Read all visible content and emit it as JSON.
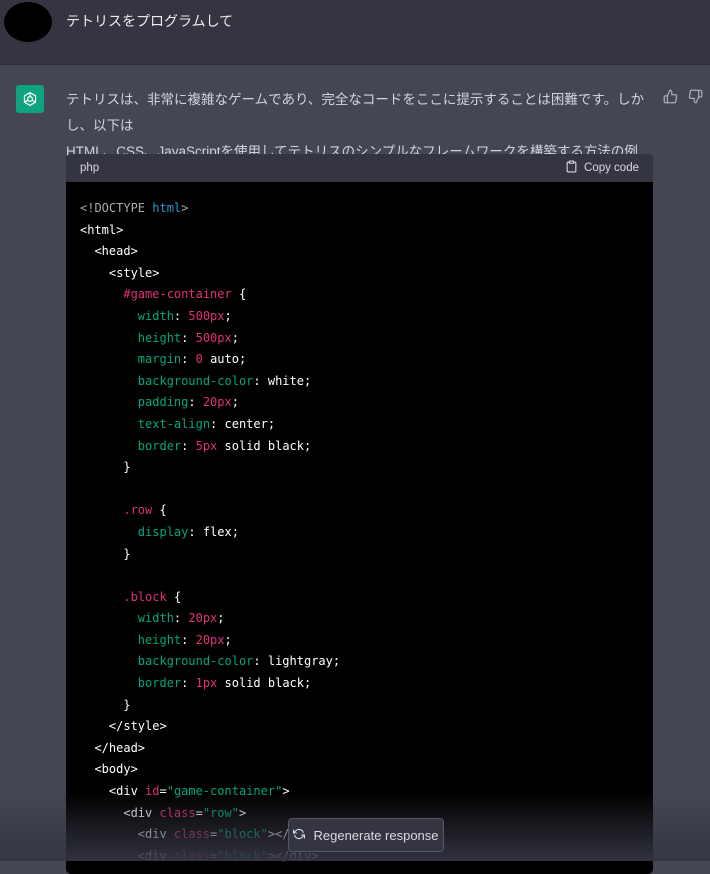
{
  "user_message": {
    "text": "テトリスをプログラムして"
  },
  "assistant": {
    "intro_line1": "テトリスは、非常に複雑なゲームであり、完全なコードをここに提示することは困難です。しかし、以下は",
    "intro_line2": "HTML、CSS、JavaScriptを使用してテトリスのシンプルなフレームワークを構築する方法の例です。",
    "code": {
      "language": "php",
      "copy_label": "Copy code",
      "lines": [
        [
          {
            "t": "<!DOCTYPE ",
            "c": "c"
          },
          {
            "t": "html",
            "c": "t"
          },
          {
            "t": ">",
            "c": "c"
          }
        ],
        [
          {
            "t": "<html>",
            "c": ""
          }
        ],
        [
          {
            "t": "  <head>",
            "c": ""
          }
        ],
        [
          {
            "t": "    <style>",
            "c": ""
          }
        ],
        [
          {
            "t": "      ",
            "c": ""
          },
          {
            "t": "#game-container",
            "c": "n"
          },
          {
            "t": " {",
            "c": ""
          }
        ],
        [
          {
            "t": "        ",
            "c": ""
          },
          {
            "t": "width",
            "c": "k"
          },
          {
            "t": ": ",
            "c": ""
          },
          {
            "t": "500px",
            "c": "n"
          },
          {
            "t": ";",
            "c": ""
          }
        ],
        [
          {
            "t": "        ",
            "c": ""
          },
          {
            "t": "height",
            "c": "k"
          },
          {
            "t": ": ",
            "c": ""
          },
          {
            "t": "500px",
            "c": "n"
          },
          {
            "t": ";",
            "c": ""
          }
        ],
        [
          {
            "t": "        ",
            "c": ""
          },
          {
            "t": "margin",
            "c": "k"
          },
          {
            "t": ": ",
            "c": ""
          },
          {
            "t": "0",
            "c": "n"
          },
          {
            "t": " auto;",
            "c": ""
          }
        ],
        [
          {
            "t": "        ",
            "c": ""
          },
          {
            "t": "background-color",
            "c": "k"
          },
          {
            "t": ": white;",
            "c": ""
          }
        ],
        [
          {
            "t": "        ",
            "c": ""
          },
          {
            "t": "padding",
            "c": "k"
          },
          {
            "t": ": ",
            "c": ""
          },
          {
            "t": "20px",
            "c": "n"
          },
          {
            "t": ";",
            "c": ""
          }
        ],
        [
          {
            "t": "        ",
            "c": ""
          },
          {
            "t": "text-align",
            "c": "k"
          },
          {
            "t": ": center;",
            "c": ""
          }
        ],
        [
          {
            "t": "        ",
            "c": ""
          },
          {
            "t": "border",
            "c": "k"
          },
          {
            "t": ": ",
            "c": ""
          },
          {
            "t": "5px",
            "c": "n"
          },
          {
            "t": " solid black;",
            "c": ""
          }
        ],
        [
          {
            "t": "      }",
            "c": ""
          }
        ],
        [
          {
            "t": "",
            "c": ""
          }
        ],
        [
          {
            "t": "      ",
            "c": ""
          },
          {
            "t": ".row",
            "c": "n"
          },
          {
            "t": " {",
            "c": ""
          }
        ],
        [
          {
            "t": "        ",
            "c": ""
          },
          {
            "t": "display",
            "c": "k"
          },
          {
            "t": ": flex;",
            "c": ""
          }
        ],
        [
          {
            "t": "      }",
            "c": ""
          }
        ],
        [
          {
            "t": "",
            "c": ""
          }
        ],
        [
          {
            "t": "      ",
            "c": ""
          },
          {
            "t": ".block",
            "c": "n"
          },
          {
            "t": " {",
            "c": ""
          }
        ],
        [
          {
            "t": "        ",
            "c": ""
          },
          {
            "t": "width",
            "c": "k"
          },
          {
            "t": ": ",
            "c": ""
          },
          {
            "t": "20px",
            "c": "n"
          },
          {
            "t": ";",
            "c": ""
          }
        ],
        [
          {
            "t": "        ",
            "c": ""
          },
          {
            "t": "height",
            "c": "k"
          },
          {
            "t": ": ",
            "c": ""
          },
          {
            "t": "20px",
            "c": "n"
          },
          {
            "t": ";",
            "c": ""
          }
        ],
        [
          {
            "t": "        ",
            "c": ""
          },
          {
            "t": "background-color",
            "c": "k"
          },
          {
            "t": ": lightgray;",
            "c": ""
          }
        ],
        [
          {
            "t": "        ",
            "c": ""
          },
          {
            "t": "border",
            "c": "k"
          },
          {
            "t": ": ",
            "c": ""
          },
          {
            "t": "1px",
            "c": "n"
          },
          {
            "t": " solid black;",
            "c": ""
          }
        ],
        [
          {
            "t": "      }",
            "c": ""
          }
        ],
        [
          {
            "t": "    </style>",
            "c": ""
          }
        ],
        [
          {
            "t": "  </head>",
            "c": ""
          }
        ],
        [
          {
            "t": "  <body>",
            "c": ""
          }
        ],
        [
          {
            "t": "    <div ",
            "c": ""
          },
          {
            "t": "id",
            "c": "n"
          },
          {
            "t": "=",
            "c": ""
          },
          {
            "t": "\"game-container\"",
            "c": "s"
          },
          {
            "t": ">",
            "c": ""
          }
        ],
        [
          {
            "t": "      <div ",
            "c": ""
          },
          {
            "t": "class",
            "c": "n"
          },
          {
            "t": "=",
            "c": ""
          },
          {
            "t": "\"row\"",
            "c": "s"
          },
          {
            "t": ">",
            "c": ""
          }
        ],
        [
          {
            "t": "        <div ",
            "c": ""
          },
          {
            "t": "class",
            "c": "n"
          },
          {
            "t": "=",
            "c": ""
          },
          {
            "t": "\"block\"",
            "c": "s"
          },
          {
            "t": "></div>",
            "c": ""
          }
        ],
        [
          {
            "t": "        <div ",
            "c": ""
          },
          {
            "t": "class",
            "c": "n"
          },
          {
            "t": "=",
            "c": ""
          },
          {
            "t": "\"block\"",
            "c": "s"
          },
          {
            "t": "></div>",
            "c": ""
          }
        ]
      ]
    },
    "regenerate_label": "Regenerate response"
  },
  "icons": {
    "openai_logo": "openai-logo-icon",
    "thumb_up": "thumbs-up-icon",
    "thumb_down": "thumbs-down-icon",
    "clipboard": "clipboard-icon",
    "refresh": "refresh-icon"
  },
  "colors": {
    "page_bg": "#444654",
    "user_row_bg": "#343541",
    "code_bg": "#000000",
    "brand": "#10a37f"
  }
}
